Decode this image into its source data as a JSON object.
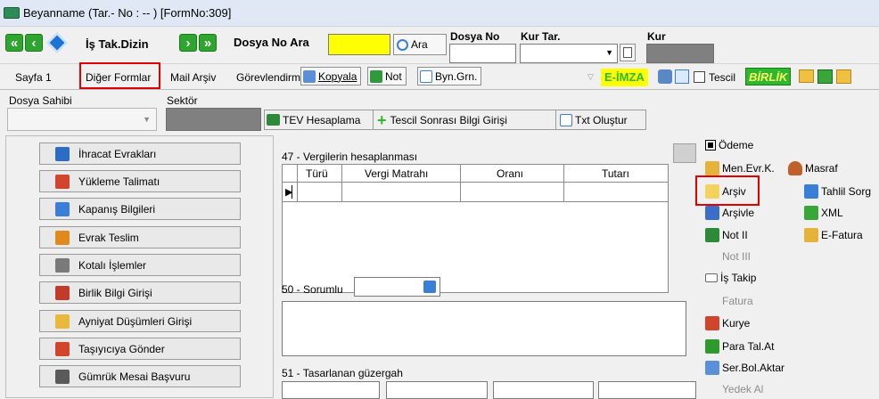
{
  "window": {
    "title": "Beyanname (Tar.- No : -- ) [FormNo:309]"
  },
  "toolbar": {
    "is_takip_label": "İş Tak.Dizin",
    "dosya_no_ara_label": "Dosya No Ara",
    "ara_button": "Ara",
    "dosya_no_label": "Dosya No",
    "kur_tar_label": "Kur Tar.",
    "kur_label": "Kur",
    "dosya_no_ara_value": "",
    "dosya_no_value": ""
  },
  "tabs": {
    "sayfa1": "Sayfa 1",
    "diger_formlar": "Diğer Formlar",
    "mail_arsiv": "Mail Arşiv",
    "gorevlendirme": "Görevlendirme",
    "kopyala": "Kopyala",
    "not": "Not",
    "byn_grn": "Byn.Grn.",
    "e_imza": "E-İMZA",
    "tescil": "Tescil",
    "birlik": "BİRLİK"
  },
  "info": {
    "dosya_sahibi_label": "Dosya Sahibi",
    "sektor_label": "Sektör",
    "tev_hesaplama": "TEV Hesaplama",
    "tescil_sonrasi": "Tescil Sonrası Bilgi Girişi",
    "txt_olustur": "Txt Oluştur"
  },
  "side_buttons": [
    {
      "label": "İhracat Evrakları",
      "icon": "document-icon",
      "color": "#2b6cc4"
    },
    {
      "label": "Yükleme Talimatı",
      "icon": "truck-icon",
      "color": "#d0452b"
    },
    {
      "label": "Kapanış Bilgileri",
      "icon": "edit-doc-icon",
      "color": "#3a7ed8"
    },
    {
      "label": "Evrak Teslim",
      "icon": "handover-icon",
      "color": "#e08a1e"
    },
    {
      "label": "Kotalı İşlemler",
      "icon": "calendar-icon",
      "color": "#7a7a7a"
    },
    {
      "label": "Birlik Bilgi Girişi",
      "icon": "database-icon",
      "color": "#c23a2a"
    },
    {
      "label": "Ayniyat Düşümleri Girişi",
      "icon": "eraser-icon",
      "color": "#e8b93a"
    },
    {
      "label": "Taşıyıcıya Gönder",
      "icon": "truck-icon",
      "color": "#d0452b"
    },
    {
      "label": "Gümrük Mesai Başvuru",
      "icon": "pencil-doc-icon",
      "color": "#5a5a5a"
    }
  ],
  "center": {
    "vergi_title": "47 - Vergilerin hesaplanması",
    "columns": [
      "Türü",
      "Vergi Matrahı",
      "Oranı",
      "Tutarı"
    ],
    "sorumlu_label": "50 - Sorumlu",
    "guzergah_label": "51 - Tasarlanan güzergah"
  },
  "right_panel": {
    "odeme": "Ödeme",
    "men_evr_k": "Men.Evr.K.",
    "masraf": "Masraf",
    "arsiv": "Arşiv",
    "tahlil_sorg": "Tahlil Sorg",
    "arsivle": "Arşivle",
    "xml": "XML",
    "not_ii": "Not II",
    "e_fatura": "E-Fatura",
    "not_iii": "Not III",
    "is_takip": "İş Takip",
    "fatura": "Fatura",
    "kurye": "Kurye",
    "para_tal_at": "Para Tal.At",
    "ser_bol_aktar": "Ser.Bol.Aktar",
    "yedek_al": "Yedek Al"
  },
  "colors": {
    "highlight": "#e00000",
    "birlik": "#2eb82e",
    "e_imza_bg": "#ffff00"
  }
}
